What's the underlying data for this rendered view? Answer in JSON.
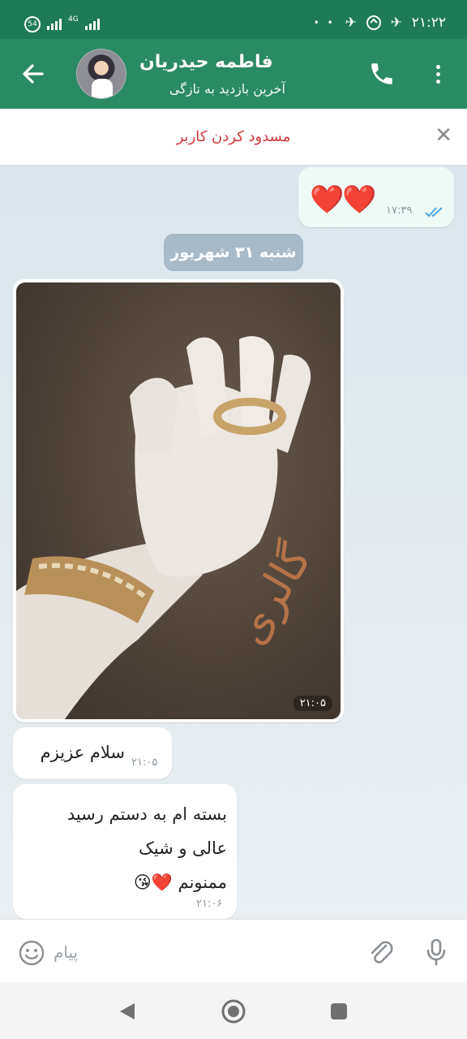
{
  "status_bar": {
    "time": "۲۱:۲۲",
    "badge": "54",
    "network": "4G",
    "dots": "• •"
  },
  "header": {
    "contact_name": "فاطمه حیدریان",
    "last_seen": "آخرین بازدید به تازگی"
  },
  "block_banner": {
    "label": "مسدود کردن کاربر"
  },
  "messages": {
    "m1": {
      "text": "❤️❤️",
      "time": "۱۷:۳۹"
    },
    "date_separator": "شنبه ۳۱ شهریور",
    "photo": {
      "time": "۲۱:۰۵"
    },
    "m2": {
      "text": "سلام عزیزم",
      "time": "۲۱:۰۵"
    },
    "m3": {
      "line1": "بسته ام به دستم رسید",
      "line2": "عالی و شیک",
      "line3": "ممنونم ❤️😘",
      "time": "۲۱:۰۶"
    }
  },
  "input": {
    "placeholder": "پیام",
    "value": ""
  },
  "colors": {
    "header": "#2a8a63",
    "status_bar": "#1e7a57",
    "block_text": "#d33a3a",
    "read_ticks": "#4aa3df"
  }
}
